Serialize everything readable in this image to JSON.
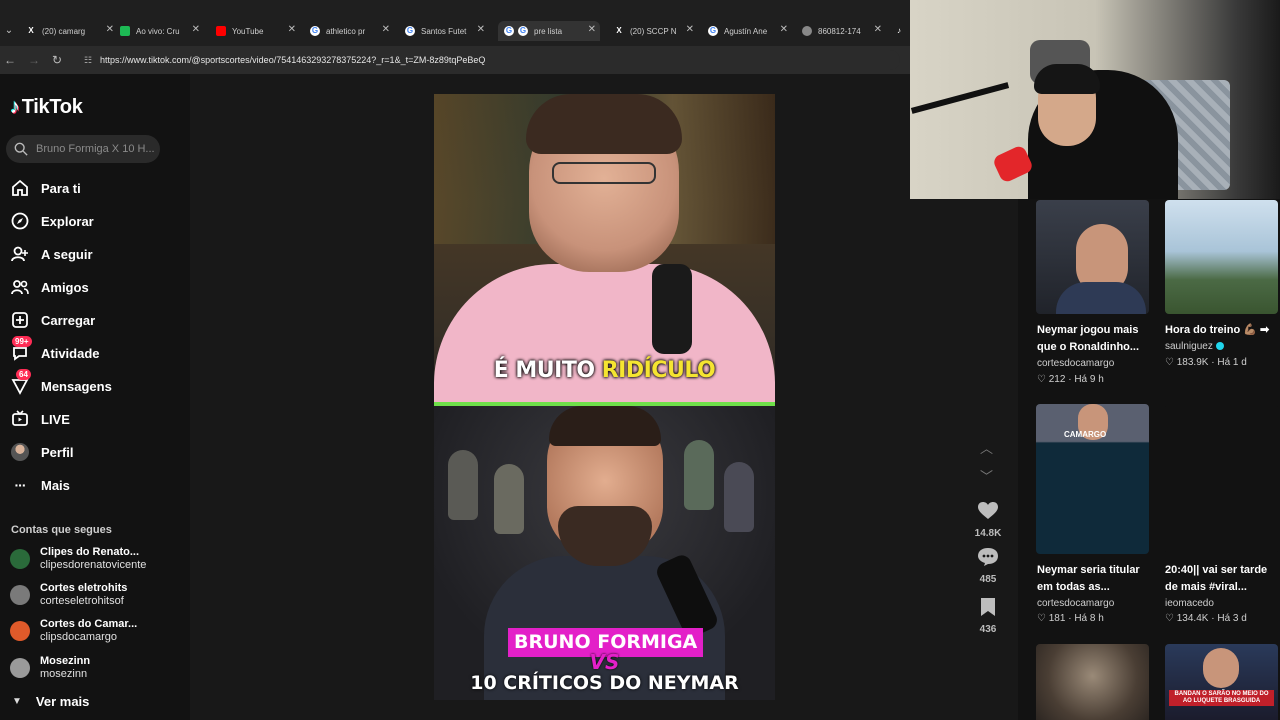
{
  "browser": {
    "tabs": [
      {
        "label": "(20) camarg",
        "icon": "x-logo-icon",
        "color": "#000000"
      },
      {
        "label": "Ao vivo: Cru",
        "icon": "green-play-icon",
        "color": "#1db954"
      },
      {
        "label": "YouTube",
        "icon": "youtube-icon",
        "color": "#ff0000"
      },
      {
        "label": "athletico pr",
        "icon": "google-icon",
        "color": "#4285f4"
      },
      {
        "label": "Santos Futet",
        "icon": "google-icon",
        "color": "#4285f4"
      },
      {
        "label": "pre lista",
        "icon": "google-icon",
        "color": "#4285f4"
      },
      {
        "label": "(20) SCCP N",
        "icon": "x-logo-icon",
        "color": "#000000"
      },
      {
        "label": "Agustín Ane",
        "icon": "google-icon",
        "color": "#4285f4"
      },
      {
        "label": "860812-174",
        "icon": "globe-icon",
        "color": "#888888"
      }
    ],
    "url": "https://www.tiktok.com/@sportscortes/video/7541463293278375224?_r=1&_t=ZM-8z89tqPeBeQ"
  },
  "tiktok": {
    "logo": "TikTok",
    "search_placeholder": "Bruno Formiga X 10 H...",
    "nav": [
      {
        "label": "Para ti",
        "icon": "home-icon"
      },
      {
        "label": "Explorar",
        "icon": "compass-icon"
      },
      {
        "label": "A seguir",
        "icon": "following-icon"
      },
      {
        "label": "Amigos",
        "icon": "friends-icon"
      },
      {
        "label": "Carregar",
        "icon": "upload-icon"
      },
      {
        "label": "Atividade",
        "icon": "activity-icon",
        "badge": "99+"
      },
      {
        "label": "Mensagens",
        "icon": "messages-icon",
        "badge": "64"
      },
      {
        "label": "LIVE",
        "icon": "live-icon"
      },
      {
        "label": "Perfil",
        "icon": "profile-avatar-icon"
      },
      {
        "label": "Mais",
        "icon": "more-icon"
      }
    ],
    "following_title": "Contas que segues",
    "following": [
      {
        "name": "Clipes do Renato...",
        "handle": "clipesdorenatovicente",
        "color": "#2a6a3a"
      },
      {
        "name": "Cortes eletrohits",
        "handle": "corteseletrohitsof",
        "color": "#7a7a7a"
      },
      {
        "name": "Cortes do Camar...",
        "handle": "clipsdocamargo",
        "color": "#e05a2a"
      },
      {
        "name": "Mosezinn",
        "handle": "mosezinn",
        "color": "#9a9a9a"
      }
    ],
    "see_more": "Ver mais"
  },
  "video": {
    "caption_top_prefix": "É MUITO",
    "caption_top_highlight": "RIDÍCULO",
    "title_line1": "BRUNO FORMIGA",
    "title_vs": "VS",
    "title_line2": "10 CRÍTICOS DO NEYMAR",
    "likes": "14.8K",
    "comments": "485",
    "saves": "436"
  },
  "suggestions": [
    {
      "title_l1": "Neymar jogou mais",
      "title_l2": "que o Ronaldinho...",
      "author": "cortesdocamargo",
      "likes": "212",
      "age": "Há 9 h"
    },
    {
      "title_l1": "Hora do treino 💪🏽 ➡",
      "title_l2": "",
      "author": "saulniguez",
      "verified": true,
      "likes": "183.9K",
      "age": "Há 1 d"
    },
    {
      "title_l1": "Neymar seria titular",
      "title_l2": "em todas as...",
      "author": "cortesdocamargo",
      "likes": "181",
      "age": "Há 8 h",
      "thumb_text": "CAMARGO"
    },
    {
      "title_l1": "20:40|| vai ser tarde",
      "title_l2": "de mais #viral...",
      "author": "ieomacedo",
      "likes": "134.4K",
      "age": "Há 3 d"
    },
    {
      "title_l1": "",
      "title_l2": "",
      "author": "",
      "likes": "",
      "age": ""
    },
    {
      "title_l1": "",
      "title_l2": "",
      "author": "",
      "likes": "",
      "age": "",
      "thumb_text": "BANDAN O SARÃO NO MEIO DO AO LUQUETE BRASGUIDA"
    }
  ]
}
